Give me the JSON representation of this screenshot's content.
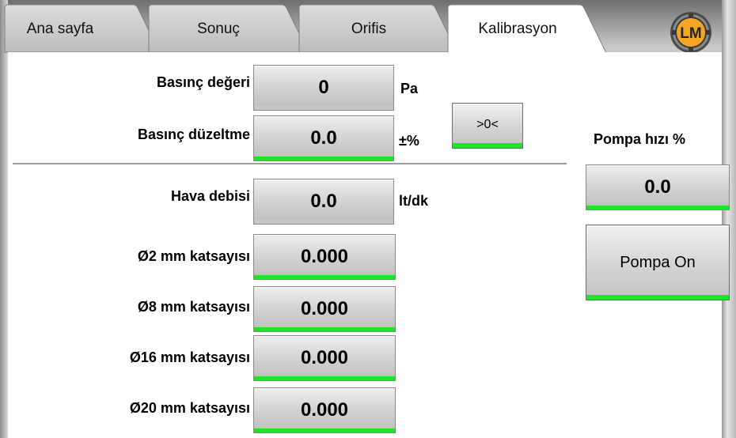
{
  "tabs": [
    {
      "label": "Ana sayfa",
      "active": false
    },
    {
      "label": "Sonuç",
      "active": false
    },
    {
      "label": "Orifis",
      "active": false
    },
    {
      "label": "Kalibrasyon",
      "active": true
    }
  ],
  "logo": {
    "text": "LM",
    "icon": "lm-logo-icon"
  },
  "pressure": {
    "label": "Basınç değeri",
    "value": "0",
    "unit": "Pa"
  },
  "pressure_correction": {
    "label": "Basınç düzeltme",
    "value": "0.0",
    "unit": "±%"
  },
  "zero_button": {
    "label": ">0<"
  },
  "air_flow": {
    "label": "Hava debisi",
    "value": "0.0",
    "unit": "lt/dk"
  },
  "coefficients": [
    {
      "label": "Ø2 mm katsayısı",
      "value": "0.000"
    },
    {
      "label": "Ø8 mm katsayısı",
      "value": "0.000"
    },
    {
      "label": "Ø16 mm katsayısı",
      "value": "0.000"
    },
    {
      "label": "Ø20 mm katsayısı",
      "value": "0.000"
    }
  ],
  "pump": {
    "speed_label": "Pompa hızı %",
    "speed_value": "0.0",
    "button_label": "Pompa On"
  },
  "colors": {
    "indicator_green": "#1ee32a",
    "tab_active": "#ffffff",
    "tab_inactive": "#c8c8c8"
  }
}
